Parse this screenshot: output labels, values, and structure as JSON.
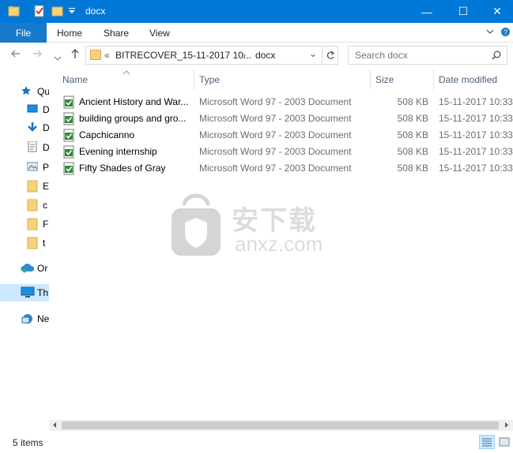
{
  "window": {
    "title": "docx",
    "controls": {
      "minimize": "—",
      "maximize": "☐",
      "close": "✕"
    }
  },
  "ribbon": {
    "tabs": [
      "File",
      "Home",
      "Share",
      "View"
    ],
    "expand_icon": "chevron-down",
    "help_icon": "question"
  },
  "address_bar": {
    "overflow": "«",
    "path": [
      "BITRECOVER_15-11-2017 10...",
      "docx"
    ],
    "separator": "›",
    "dropdown": "⌄"
  },
  "search": {
    "placeholder": "Search docx"
  },
  "nav_pane": {
    "items": [
      {
        "label": "Qu",
        "icon": "quick-access-star"
      },
      {
        "label": "D",
        "icon": "desktop"
      },
      {
        "label": "D",
        "icon": "downloads"
      },
      {
        "label": "D",
        "icon": "documents"
      },
      {
        "label": "P",
        "icon": "pictures"
      },
      {
        "label": "E",
        "icon": "folder"
      },
      {
        "label": "c",
        "icon": "folder"
      },
      {
        "label": "F",
        "icon": "folder"
      },
      {
        "label": "t",
        "icon": "folder"
      },
      {
        "label": "Or",
        "icon": "onedrive"
      },
      {
        "label": "Th",
        "icon": "this-pc"
      },
      {
        "label": "Ne",
        "icon": "network"
      }
    ],
    "selected_index": 10
  },
  "file_list": {
    "columns": [
      "Name",
      "Type",
      "Size",
      "Date modified"
    ],
    "rows": [
      {
        "name": "Ancient History and War...",
        "type": "Microsoft Word 97 - 2003 Document",
        "size": "508 KB",
        "date": "15-11-2017 10:33"
      },
      {
        "name": "building groups and gro...",
        "type": "Microsoft Word 97 - 2003 Document",
        "size": "508 KB",
        "date": "15-11-2017 10:33"
      },
      {
        "name": "Capchicanno",
        "type": "Microsoft Word 97 - 2003 Document",
        "size": "508 KB",
        "date": "15-11-2017 10:33"
      },
      {
        "name": "Evening internship",
        "type": "Microsoft Word 97 - 2003 Document",
        "size": "508 KB",
        "date": "15-11-2017 10:33"
      },
      {
        "name": "Fifty Shades of Gray",
        "type": "Microsoft Word 97 - 2003 Document",
        "size": "508 KB",
        "date": "15-11-2017 10:33"
      }
    ]
  },
  "watermark": {
    "cn": "安下载",
    "en": "anxz.com"
  },
  "status": {
    "items_count": "5 items"
  },
  "colors": {
    "titlebar": "#0078d7",
    "file_tab": "#1979ca",
    "selection": "#cce8ff"
  }
}
